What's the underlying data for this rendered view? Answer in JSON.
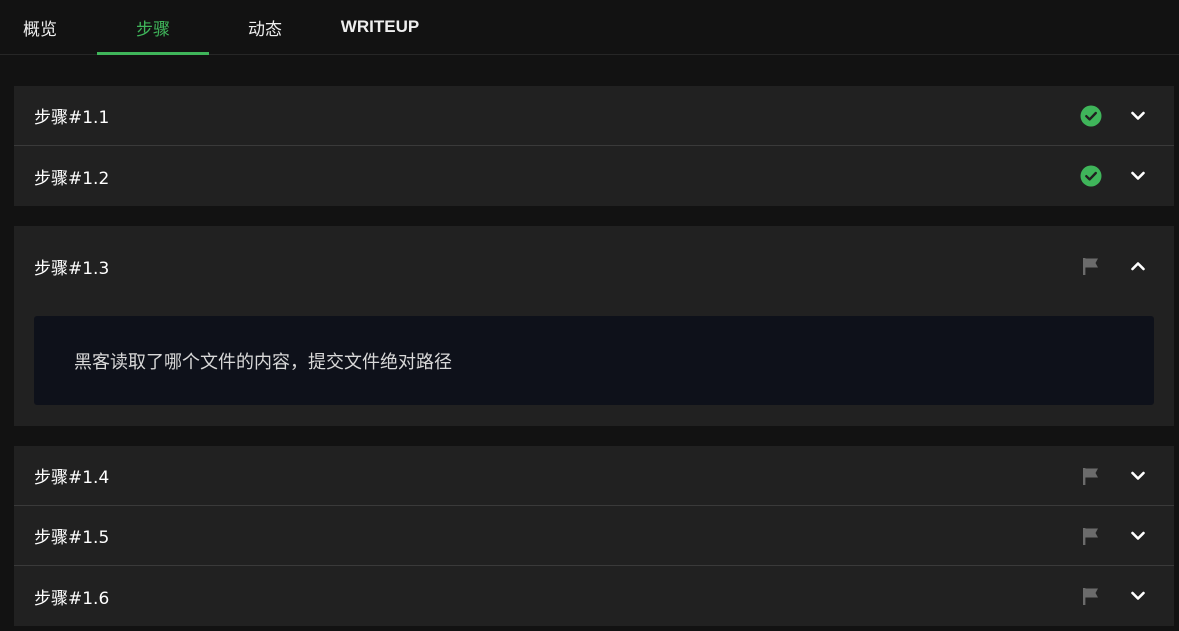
{
  "tabs": [
    {
      "label": "概览"
    },
    {
      "label": "步骤",
      "active": true
    },
    {
      "label": "动态"
    },
    {
      "label": "WRITEUP"
    }
  ],
  "steps_group1": [
    {
      "label": "步骤#1.1",
      "status": "check-circle-icon"
    },
    {
      "label": "步骤#1.2",
      "status": "check-circle-icon"
    }
  ],
  "step_expanded": {
    "label": "步骤#1.3",
    "status": "flag-icon",
    "question": "黑客读取了哪个文件的内容，提交文件绝对路径"
  },
  "steps_group3": [
    {
      "label": "步骤#1.4",
      "status": "flag-icon"
    },
    {
      "label": "步骤#1.5",
      "status": "flag-icon"
    },
    {
      "label": "步骤#1.6",
      "status": "flag-icon"
    }
  ],
  "colors": {
    "accent": "#3fb55a",
    "flag": "#6b6b6b",
    "panel": "#212121",
    "question_bg": "#0e111a"
  }
}
